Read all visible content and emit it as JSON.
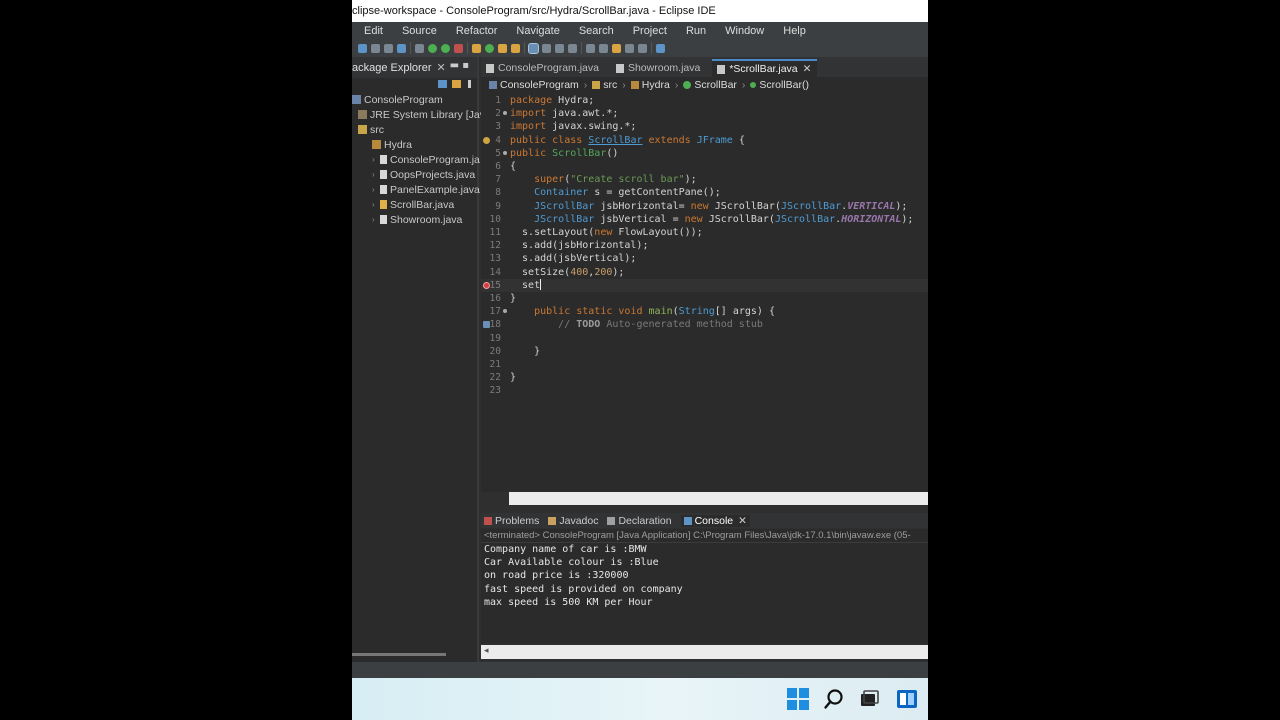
{
  "window": {
    "title": "clipse-workspace - ConsoleProgram/src/Hydra/ScrollBar.java - Eclipse IDE"
  },
  "menu": [
    "Edit",
    "Source",
    "Refactor",
    "Navigate",
    "Search",
    "Project",
    "Run",
    "Window",
    "Help"
  ],
  "package_explorer": {
    "tab_label": "ackage Explorer",
    "tree": [
      {
        "label": "ConsoleProgram",
        "icon": "project-icon"
      },
      {
        "label": "JRE System Library [JavaSE",
        "icon": "library-icon"
      },
      {
        "label": "src",
        "icon": "source-folder-icon"
      },
      {
        "label": "Hydra",
        "icon": "package-icon"
      },
      {
        "label": "ConsoleProgram.ja",
        "icon": "java-file-icon"
      },
      {
        "label": "OopsProjects.java",
        "icon": "java-file-icon"
      },
      {
        "label": "PanelExample.java",
        "icon": "java-file-icon"
      },
      {
        "label": "ScrollBar.java",
        "icon": "java-file-icon"
      },
      {
        "label": "Showroom.java",
        "icon": "java-file-icon"
      }
    ]
  },
  "editor": {
    "tabs": [
      {
        "label": "ConsoleProgram.java"
      },
      {
        "label": "Showroom.java"
      },
      {
        "label": "*ScrollBar.java"
      }
    ],
    "breadcrumb": [
      "ConsoleProgram",
      "src",
      "Hydra",
      "ScrollBar",
      "ScrollBar()"
    ],
    "line_numbers": [
      "1",
      "2",
      "3",
      "4",
      "5",
      "6",
      "7",
      "8",
      "9",
      "10",
      "11",
      "12",
      "13",
      "14",
      "15",
      "16",
      "17",
      "18",
      "19",
      "20",
      "21",
      "22",
      "23"
    ]
  },
  "bottom_panel": {
    "tabs": [
      "Problems",
      "Javadoc",
      "Declaration",
      "Console"
    ],
    "console_header": "<terminated> ConsoleProgram [Java Application] C:\\Program Files\\Java\\jdk-17.0.1\\bin\\javaw.exe  (05-",
    "output": [
      "Company name of car is :BMW",
      "Car Available colour is :Blue",
      "on road price is :320000",
      "fast speed is provided on company",
      "max speed is 500 KM per Hour"
    ]
  },
  "colors": {
    "background": "#2b2b2b",
    "keyword": "#cc7832",
    "type": "#4e9bd3",
    "string": "#6a9955"
  }
}
